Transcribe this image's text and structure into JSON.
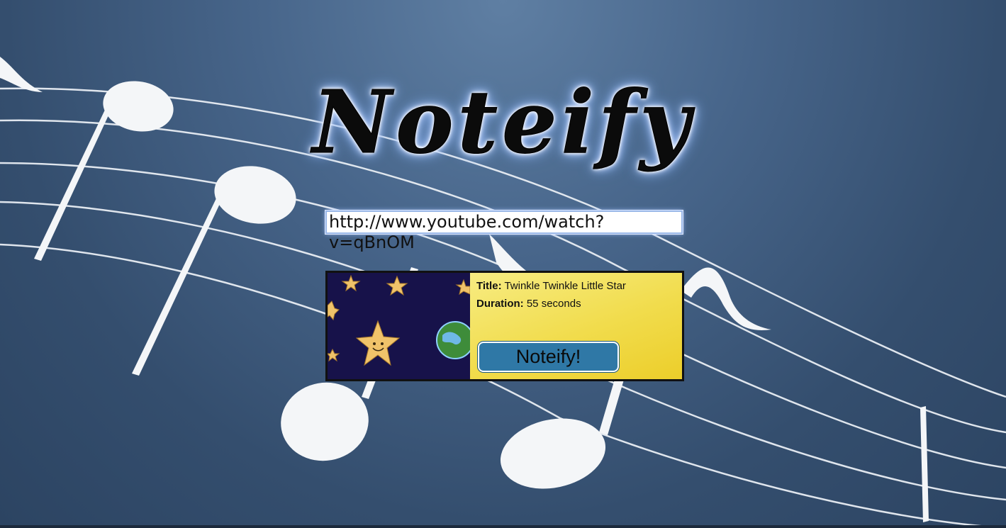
{
  "app": {
    "logo_text": "Noteify"
  },
  "search": {
    "url_value": "http://www.youtube.com/watch?v=qBnOM"
  },
  "video": {
    "title_label": "Title:",
    "title": "Twinkle Twinkle Little Star",
    "duration_label": "Duration:",
    "duration": "55 seconds",
    "thumbnail": "stars-and-earth-thumbnail"
  },
  "actions": {
    "noteify_label": "Noteify!"
  },
  "colors": {
    "background": "#3f5c80",
    "card_yellow": "#f1dc4c",
    "button_blue": "#2f78a6",
    "notes_white": "#ffffff"
  }
}
